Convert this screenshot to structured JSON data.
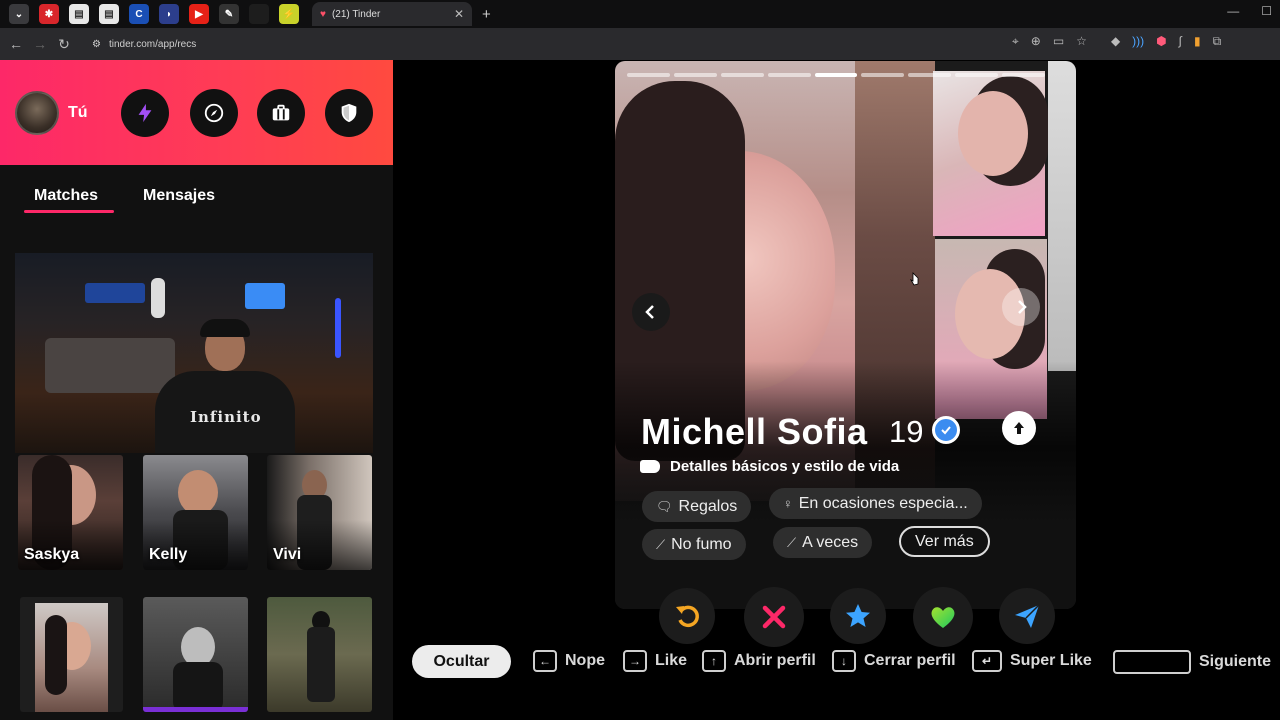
{
  "browser": {
    "tab_title": "(21) Tinder",
    "url": "tinder.com/app/recs"
  },
  "header": {
    "me_label": "Tú"
  },
  "tabs": {
    "matches": "Matches",
    "messages": "Mensajes"
  },
  "webcam": {
    "shirt_text": "Infinito"
  },
  "matches": [
    {
      "name": "Saskya"
    },
    {
      "name": "Kelly"
    },
    {
      "name": "Vivi"
    }
  ],
  "profile": {
    "name": "Michell Sofia",
    "age": "19",
    "details_label": "Detalles básicos y estilo de vida",
    "chips": [
      {
        "label": "Regalos",
        "icon": "gift-icon"
      },
      {
        "label": "En ocasiones especia...",
        "icon": "glass-icon"
      },
      {
        "label": "No fumo",
        "icon": "cigarette-icon"
      },
      {
        "label": "A veces",
        "icon": "drink-icon"
      },
      {
        "label": "Ver más",
        "icon": ""
      }
    ],
    "photo_count": 9,
    "active_photo_index": 4
  },
  "actions": [
    {
      "name": "rewind",
      "color": "#f5a623"
    },
    {
      "name": "nope",
      "color": "#fd2868"
    },
    {
      "name": "super-like",
      "color": "#3ca4ff"
    },
    {
      "name": "like",
      "color": "#35d35a"
    },
    {
      "name": "boost",
      "color": "#3ca4ff"
    }
  ],
  "hints": {
    "hide": "Ocultar",
    "nope": "Nope",
    "like": "Like",
    "open": "Abrir perfil",
    "close": "Cerrar perfil",
    "super": "Super Like",
    "next": "Siguiente"
  }
}
